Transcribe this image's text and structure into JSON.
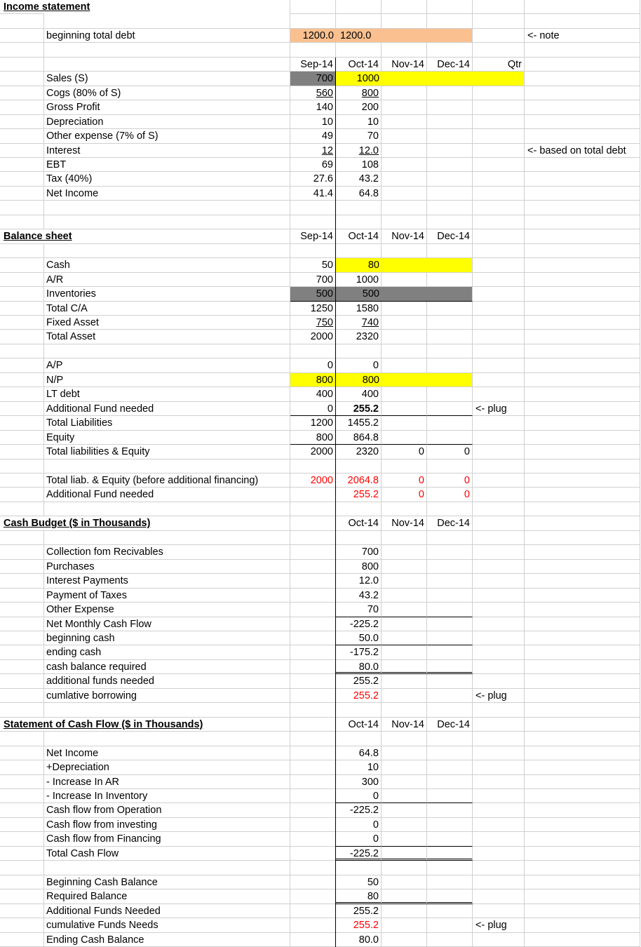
{
  "income_statement": {
    "title": "Income statement",
    "beginning_debt": {
      "label": "beginning total debt",
      "values": [
        "1200.0",
        "1200.0"
      ],
      "note": "<- note"
    },
    "months": [
      "Sep-14",
      "Oct-14",
      "Nov-14",
      "Dec-14"
    ],
    "qtr_label": "Qtr",
    "rows": [
      {
        "label": "Sales (S)",
        "values": [
          "700",
          "1000"
        ]
      },
      {
        "label": "Cogs (80% of S)",
        "values": [
          "560",
          "800"
        ]
      },
      {
        "label": "Gross Profit",
        "values": [
          "140",
          "200"
        ]
      },
      {
        "label": "Depreciation",
        "values": [
          "10",
          "10"
        ]
      },
      {
        "label": "Other expense (7% of S)",
        "values": [
          "49",
          "70"
        ]
      },
      {
        "label": "Interest",
        "values": [
          "12",
          "12.0"
        ],
        "note": "<- based on total debt"
      },
      {
        "label": "EBT",
        "values": [
          "69",
          "108"
        ]
      },
      {
        "label": "Tax (40%)",
        "values": [
          "27.6",
          "43.2"
        ]
      },
      {
        "label": "Net Income",
        "values": [
          "41.4",
          "64.8"
        ]
      }
    ]
  },
  "balance_sheet": {
    "title": "Balance sheet",
    "months": [
      "Sep-14",
      "Oct-14",
      "Nov-14",
      "Dec-14"
    ],
    "assets": [
      {
        "label": "Cash",
        "values": [
          "50",
          "80"
        ]
      },
      {
        "label": "A/R",
        "values": [
          "700",
          "1000"
        ]
      },
      {
        "label": "Inventories",
        "values": [
          "500",
          "500"
        ]
      },
      {
        "label": "Total C/A",
        "values": [
          "1250",
          "1580"
        ]
      },
      {
        "label": "Fixed Asset",
        "values": [
          "750",
          "740"
        ]
      },
      {
        "label": "Total Asset",
        "values": [
          "2000",
          "2320"
        ]
      }
    ],
    "liabilities": [
      {
        "label": "A/P",
        "values": [
          "0",
          "0",
          "",
          ""
        ]
      },
      {
        "label": "N/P",
        "values": [
          "800",
          "800",
          "",
          ""
        ]
      },
      {
        "label": "LT debt",
        "values": [
          "400",
          "400",
          "",
          ""
        ]
      },
      {
        "label": "Additional Fund needed",
        "values": [
          "0",
          "255.2",
          "",
          ""
        ],
        "note": "<- plug"
      },
      {
        "label": "Total Liabilities",
        "values": [
          "1200",
          "1455.2",
          "",
          ""
        ]
      },
      {
        "label": "Equity",
        "values": [
          "800",
          "864.8",
          "",
          ""
        ]
      },
      {
        "label": "Total liabilities & Equity",
        "values": [
          "2000",
          "2320",
          "0",
          "0"
        ]
      }
    ],
    "check": [
      {
        "label": "Total liab. & Equity (before additional financing)",
        "values": [
          "2000",
          "2064.8",
          "0",
          "0"
        ]
      },
      {
        "label": "Additional Fund needed",
        "values": [
          "",
          "255.2",
          "0",
          "0"
        ]
      }
    ]
  },
  "cash_budget": {
    "title": "Cash Budget ($ in Thousands)",
    "months": [
      "Oct-14",
      "Nov-14",
      "Dec-14"
    ],
    "rows": [
      {
        "label": "Collection fom Recivables",
        "value": "700"
      },
      {
        "label": "Purchases",
        "value": "800"
      },
      {
        "label": "Interest Payments",
        "value": "12.0"
      },
      {
        "label": "Payment of Taxes",
        "value": "43.2"
      },
      {
        "label": "Other Expense",
        "value": "70"
      },
      {
        "label": "Net Monthly Cash Flow",
        "value": "-225.2"
      },
      {
        "label": "beginning cash",
        "value": "50.0"
      },
      {
        "label": "ending cash",
        "value": "-175.2"
      },
      {
        "label": "cash balance required",
        "value": "80.0"
      },
      {
        "label": "additional funds needed",
        "value": "255.2"
      },
      {
        "label": "cumlative borrowing",
        "value": "255.2",
        "note": "<- plug"
      }
    ]
  },
  "cash_flow": {
    "title": "Statement of Cash Flow ($ in Thousands)",
    "months": [
      "Oct-14",
      "Nov-14",
      "Dec-14"
    ],
    "rows": [
      {
        "label": "Net Income",
        "value": "64.8"
      },
      {
        "label": "+Depreciation",
        "value": "10"
      },
      {
        "label": "- Increase In AR",
        "value": "300"
      },
      {
        "label": "- Increase In Inventory",
        "value": "0"
      },
      {
        "label": "Cash flow from Operation",
        "value": "-225.2"
      },
      {
        "label": "Cash flow from investing",
        "value": "0"
      },
      {
        "label": "Cash flow from Financing",
        "value": "0"
      },
      {
        "label": "Total Cash Flow",
        "value": "-225.2"
      }
    ],
    "balance_rows": [
      {
        "label": "Beginning Cash Balance",
        "value": "50"
      },
      {
        "label": "Required Balance",
        "value": "80"
      },
      {
        "label": "Additional Funds Needed",
        "value": "255.2"
      },
      {
        "label": "cumulative Funds Needs",
        "value": "255.2",
        "note": "<- plug"
      },
      {
        "label": "Ending Cash Balance",
        "value": "80.0"
      }
    ]
  },
  "colors": {
    "orange": "#fac090",
    "yellow": "#ffff00",
    "gray": "#808080",
    "red": "#ff0000",
    "grid": "#d0d0d0"
  }
}
